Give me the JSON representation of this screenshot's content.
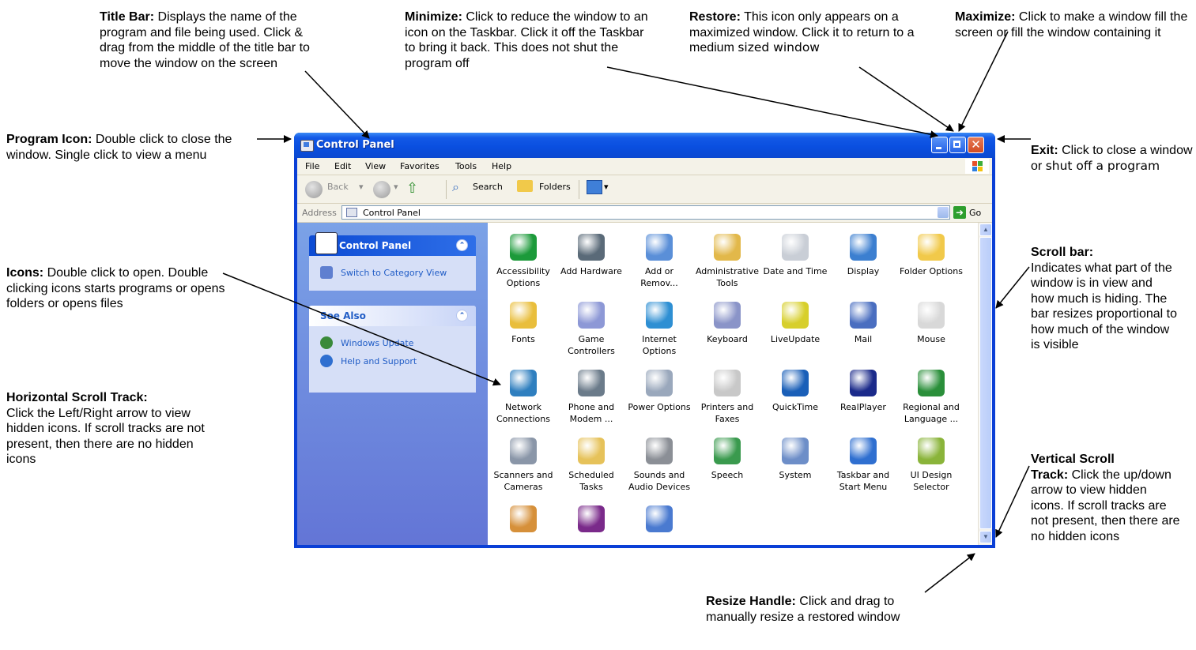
{
  "annotations": {
    "title_bar": {
      "heading": "Title Bar:",
      "body": "Displays the name of the program and file being used. Click & drag from the middle of the title bar to move the window on the screen"
    },
    "minimize": {
      "heading": "Minimize:",
      "body": "Click to reduce the window to an icon on the Taskbar. Click it off the Taskbar to bring it back. This does not shut the program off"
    },
    "restore": {
      "heading": "Restore:",
      "body": "This icon only appears on a maximized window. Click it to return to a medium",
      "body_tail": "sized window"
    },
    "maximize": {
      "heading": "Maximize:",
      "body": "Click to make a window fill the screen or fill the window containing it"
    },
    "program_icon": {
      "heading": "Program Icon:",
      "body": "Double click to close the window. Single click to view a menu"
    },
    "exit": {
      "heading": "Exit:",
      "body": "Click to close a window or",
      "body_tail": "shut off a program"
    },
    "icons": {
      "heading": "Icons:",
      "body": "Double click to open. Double clicking icons starts programs or opens folders or opens files"
    },
    "scroll_bar": {
      "heading": "Scroll bar:",
      "body": "Indicates what part of the window is in view and how much is hiding. The bar   resizes proportional to how much of the window is visible"
    },
    "horizontal_scroll": {
      "heading": "Horizontal Scroll Track:",
      "body": "Click the Left/Right arrow to view hidden icons. If scroll tracks are not present, then there are no hidden icons"
    },
    "vertical_scroll": {
      "heading": "Vertical Scroll",
      "heading2": "Track:",
      "body": "Click the up/down arrow to view hidden icons. If scroll tracks are not present, then there are no hidden icons"
    },
    "resize_handle": {
      "heading": "Resize Handle:",
      "body": "Click and drag to manually resize a restored window"
    }
  },
  "window": {
    "title": "Control Panel",
    "close_glyph": "✕",
    "menu": [
      "File",
      "Edit",
      "View",
      "Favorites",
      "Tools",
      "Help"
    ],
    "toolbar": {
      "back": "Back",
      "search": "Search",
      "folders": "Folders"
    },
    "address": {
      "label": "Address",
      "value": "Control Panel",
      "go": "Go"
    },
    "left_panel": {
      "control_panel_title": "Control Panel",
      "switch_link": "Switch to Category View",
      "see_also_title": "See Also",
      "see_also_links": [
        "Windows Update",
        "Help and Support"
      ]
    },
    "items": [
      {
        "label": "Accessibility Options",
        "icon": "accessibility-icon",
        "color": "#1c9a3a"
      },
      {
        "label": "Add Hardware",
        "icon": "add-hardware-icon",
        "color": "#5a6a78"
      },
      {
        "label": "Add or Remov...",
        "icon": "add-remove-programs-icon",
        "color": "#5a8fd8"
      },
      {
        "label": "Administrative Tools",
        "icon": "administrative-tools-icon",
        "color": "#e2b84a"
      },
      {
        "label": "Date and Time",
        "icon": "date-time-icon",
        "color": "#c9ced6"
      },
      {
        "label": "Display",
        "icon": "display-icon",
        "color": "#3c7fd0"
      },
      {
        "label": "Folder Options",
        "icon": "folder-options-icon",
        "color": "#f1c94a"
      },
      {
        "label": "Fonts",
        "icon": "fonts-icon",
        "color": "#e9be3c"
      },
      {
        "label": "Game Controllers",
        "icon": "game-controllers-icon",
        "color": "#8d98d6"
      },
      {
        "label": "Internet Options",
        "icon": "internet-options-icon",
        "color": "#2e8fd3"
      },
      {
        "label": "Keyboard",
        "icon": "keyboard-icon",
        "color": "#8a94c8"
      },
      {
        "label": "LiveUpdate",
        "icon": "liveupdate-icon",
        "color": "#d7cf2c"
      },
      {
        "label": "Mail",
        "icon": "mail-icon",
        "color": "#4a6ec0"
      },
      {
        "label": "Mouse",
        "icon": "mouse-icon",
        "color": "#d8d8d8"
      },
      {
        "label": "Network Connections",
        "icon": "network-connections-icon",
        "color": "#2f7fbf"
      },
      {
        "label": "Phone and Modem ...",
        "icon": "phone-modem-icon",
        "color": "#6b7b8a"
      },
      {
        "label": "Power Options",
        "icon": "power-options-icon",
        "color": "#9aa8bc"
      },
      {
        "label": "Printers and Faxes",
        "icon": "printers-faxes-icon",
        "color": "#c8c8c8"
      },
      {
        "label": "QuickTime",
        "icon": "quicktime-icon",
        "color": "#1a5fb8"
      },
      {
        "label": "RealPlayer",
        "icon": "realplayer-icon",
        "color": "#1b2a8a"
      },
      {
        "label": "Regional and Language ...",
        "icon": "regional-language-icon",
        "color": "#2a8f3a"
      },
      {
        "label": "Scanners and Cameras",
        "icon": "scanners-cameras-icon",
        "color": "#8a96a8"
      },
      {
        "label": "Scheduled Tasks",
        "icon": "scheduled-tasks-icon",
        "color": "#e6c25a"
      },
      {
        "label": "Sounds and Audio Devices",
        "icon": "sounds-audio-icon",
        "color": "#8b8f96"
      },
      {
        "label": "Speech",
        "icon": "speech-icon",
        "color": "#3a9a4e"
      },
      {
        "label": "System",
        "icon": "system-icon",
        "color": "#6d8ec8"
      },
      {
        "label": "Taskbar and Start Menu",
        "icon": "taskbar-start-menu-icon",
        "color": "#2f6fd0"
      },
      {
        "label": "UI Design Selector",
        "icon": "ui-design-selector-icon",
        "color": "#8ab43a"
      },
      {
        "label": "",
        "icon": "user-accounts-icon",
        "color": "#d6903a"
      },
      {
        "label": "",
        "icon": "security-center-icon",
        "color": "#7a2a8a"
      },
      {
        "label": "",
        "icon": "wireless-network-icon",
        "color": "#4a7ad0"
      }
    ]
  }
}
